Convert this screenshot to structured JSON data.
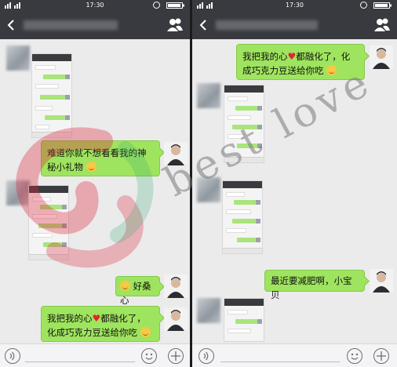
{
  "status": {
    "time": "17:30"
  },
  "left": {
    "messages": [
      {
        "text": "难道你就不想看看我的神秘小礼物"
      },
      {
        "text": "好桑心"
      },
      {
        "text": "我把我的心",
        "text_after": "都融化了，化成巧克力豆送给你吃"
      }
    ]
  },
  "right": {
    "messages": [
      {
        "text": "我把我的心",
        "text_after": "都融化了，化成巧克力豆送给你吃"
      },
      {
        "text": "最近要减肥啊，小宝贝"
      }
    ]
  },
  "watermark": {
    "text": "best love"
  },
  "icons": {
    "back": "back-arrow-icon",
    "contacts": "contacts-icon",
    "voice": "voice-icon",
    "emoji": "emoji-icon",
    "plus": "plus-icon"
  },
  "colors": {
    "bubble": "#9fe45e",
    "titlebar": "#393a3f",
    "background": "#ebebeb"
  }
}
